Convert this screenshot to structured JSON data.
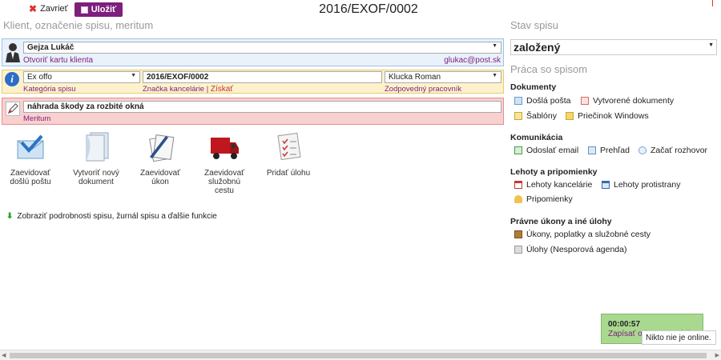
{
  "toolbar": {
    "close_label": "Zavrieť",
    "save_label": "Uložiť",
    "title": "2016/EXOF/0002"
  },
  "client_section": {
    "heading": "Klient, označenie spisu, meritum",
    "client_name": "Gejza Lukáč",
    "open_card_link": "Otvoriť kartu klienta",
    "email": "glukac@post.sk"
  },
  "office_section": {
    "category_value": "Ex offo",
    "category_label": "Kategória spisu",
    "office_mark_value": "2016/EXOF/0002",
    "office_mark_label": "Značka kancelárie",
    "separator": "|",
    "get_link": "Získať",
    "worker_value": "Klucka Roman",
    "worker_label": "Zodpovedný pracovník"
  },
  "merit_section": {
    "value": "náhrada škody za rozbité okná",
    "label": "Meritum"
  },
  "actions": [
    {
      "label1": "Zaevidovať",
      "label2": "došlú poštu",
      "label3": ""
    },
    {
      "label1": "Vytvoriť nový",
      "label2": "dokument",
      "label3": ""
    },
    {
      "label1": "Zaevidovať",
      "label2": "úkon",
      "label3": ""
    },
    {
      "label1": "Zaevidovať",
      "label2": "služobnú",
      "label3": "cestu"
    },
    {
      "label1": "Pridať úlohu",
      "label2": "",
      "label3": ""
    }
  ],
  "details_link": "Zobraziť podrobnosti spisu, žurnál spisu a ďalšie funkcie",
  "right": {
    "status_heading": "Stav spisu",
    "status_value": "založený",
    "work_heading": "Práca so spisom",
    "documents_title": "Dokumenty",
    "incoming_mail": "Došlá pošta",
    "created_docs": "Vytvorené dokumenty",
    "templates": "Šablóny",
    "windows_folder": "Priečinok Windows",
    "communication_title": "Komunikácia",
    "send_email": "Odoslať email",
    "overview": "Prehľad",
    "start_chat": "Začať rozhovor",
    "deadlines_title": "Lehoty a pripomienky",
    "office_deadlines": "Lehoty kancelárie",
    "opponent_deadlines": "Lehoty protistrany",
    "reminders": "Pripomienky",
    "legal_title": "Právne úkony a iné úlohy",
    "acts_fees": "Úkony, poplatky a služobné cesty",
    "tasks": "Úlohy (Nesporová agenda)"
  },
  "timer": {
    "value": "00:00:57",
    "link": "Zapísať odpracovaný čas"
  },
  "online_status": "Nikto nie je online.",
  "colors": {
    "accent": "#7d1f7d",
    "client_bg": "#e9f2fb",
    "office_bg": "#fdf2cc",
    "merit_bg": "#f9d0d0",
    "timer_bg": "#a9d88f"
  }
}
